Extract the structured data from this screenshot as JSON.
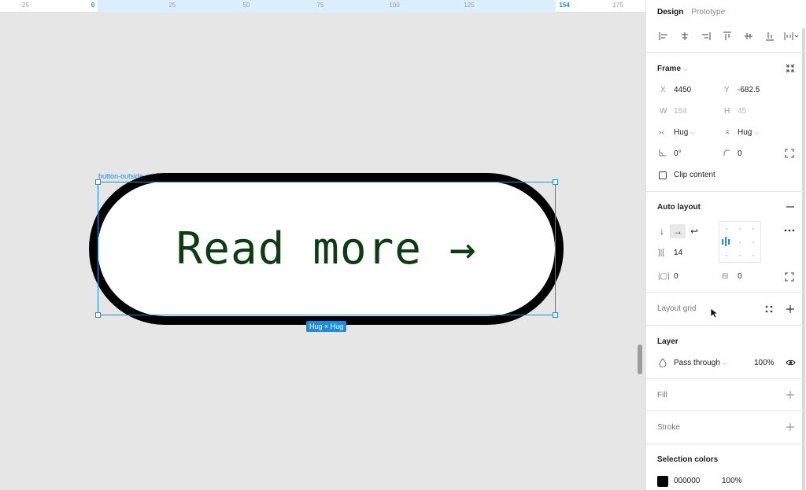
{
  "ruler": {
    "ticks": [
      "-25",
      "0",
      "25",
      "50",
      "75",
      "100",
      "125",
      "154",
      "175"
    ]
  },
  "canvas": {
    "frame_name": "button-outside-stroke",
    "button_text": "Read more →",
    "size_badge": "Hug × Hug"
  },
  "panel": {
    "tabs": {
      "design": "Design",
      "prototype": "Prototype"
    },
    "frame": {
      "title": "Frame",
      "x_label": "X",
      "x_value": "4450",
      "y_label": "Y",
      "y_value": "-682.5",
      "w_label": "W",
      "w_value": "154",
      "h_label": "H",
      "h_value": "45",
      "h_sizing": "Hug",
      "v_sizing": "Hug",
      "rotation": "0°",
      "radius": "0",
      "clip_content": "Clip content"
    },
    "auto_layout": {
      "title": "Auto layout",
      "gap": "14",
      "padding_h": "0",
      "padding_v": "0"
    },
    "layout_grid": {
      "title": "Layout grid"
    },
    "layer": {
      "title": "Layer",
      "blend": "Pass through",
      "opacity": "100%"
    },
    "fill": {
      "title": "Fill"
    },
    "stroke": {
      "title": "Stroke"
    },
    "selection_colors": {
      "title": "Selection colors",
      "hex": "000000",
      "opacity": "100%"
    }
  },
  "colors": {
    "accent": "#1a8ee0",
    "text_green": "#0d3b12",
    "stroke": "#000000"
  }
}
